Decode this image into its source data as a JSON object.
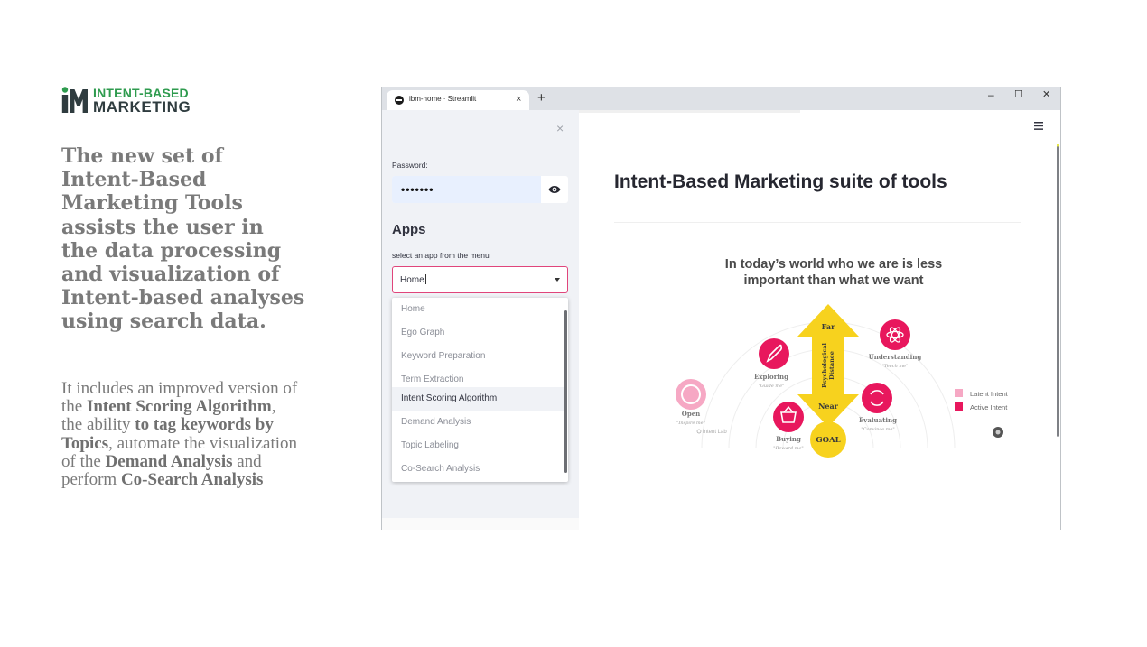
{
  "logo": {
    "line1": "INTENT-BASED",
    "line2": "MARKETING"
  },
  "slide": {
    "headline": "The new set of Intent-Based Marketing Tools assists the user in the data processing and visualization of Intent-based analyses using search data.",
    "body": {
      "t1": "It includes an improved version of the ",
      "b1": "Intent Scoring Algorithm",
      "t2": ", the ability ",
      "b2": "to tag keywords by Topics",
      "t3": ", automate the visualization of the ",
      "b3": "Demand Analysis",
      "t4": " and perform ",
      "b4": "Co-Search Analysis"
    }
  },
  "browser": {
    "tab_title": "ibm-home · Streamlit",
    "tab_close": "×",
    "new_tab": "+",
    "minimize": "–",
    "maximize": "☐",
    "close": "✕"
  },
  "sidebar": {
    "close": "×",
    "password_label": "Password:",
    "password_value": "•••••••",
    "apps_heading": "Apps",
    "apps_sub": "select an app from the menu",
    "selected": "Home",
    "options": [
      "Home",
      "Ego Graph",
      "Keyword Preparation",
      "Term Extraction",
      "Intent Scoring Algorithm",
      "Demand Analysis",
      "Topic Labeling",
      "Co-Search Analysis"
    ],
    "highlighted_index": 4
  },
  "main": {
    "title": "Intent-Based Marketing suite of tools",
    "infographic": {
      "title_line1": "In today’s world who we are is less",
      "title_line2": "important than what we want",
      "far": "Far",
      "near": "Near",
      "axis_line1": "Psychological",
      "axis_line2": "Distance",
      "goal": "GOAL",
      "stages": [
        {
          "label": "Open",
          "quote": "\"Inspire me\""
        },
        {
          "label": "Exploring",
          "quote": "\"Guide me\""
        },
        {
          "label": "Buying",
          "quote": "\"Reward me\""
        },
        {
          "label": "Evaluating",
          "quote": "\"Convince me\""
        },
        {
          "label": "Understanding",
          "quote": "\"Teach me\""
        }
      ],
      "legend": [
        "Latent Intent",
        "Active Intent"
      ],
      "source": "Intent Lab",
      "colors": {
        "active": "#e8175d",
        "latent": "#f6a8c4",
        "arrow": "#f7d21e"
      }
    }
  }
}
